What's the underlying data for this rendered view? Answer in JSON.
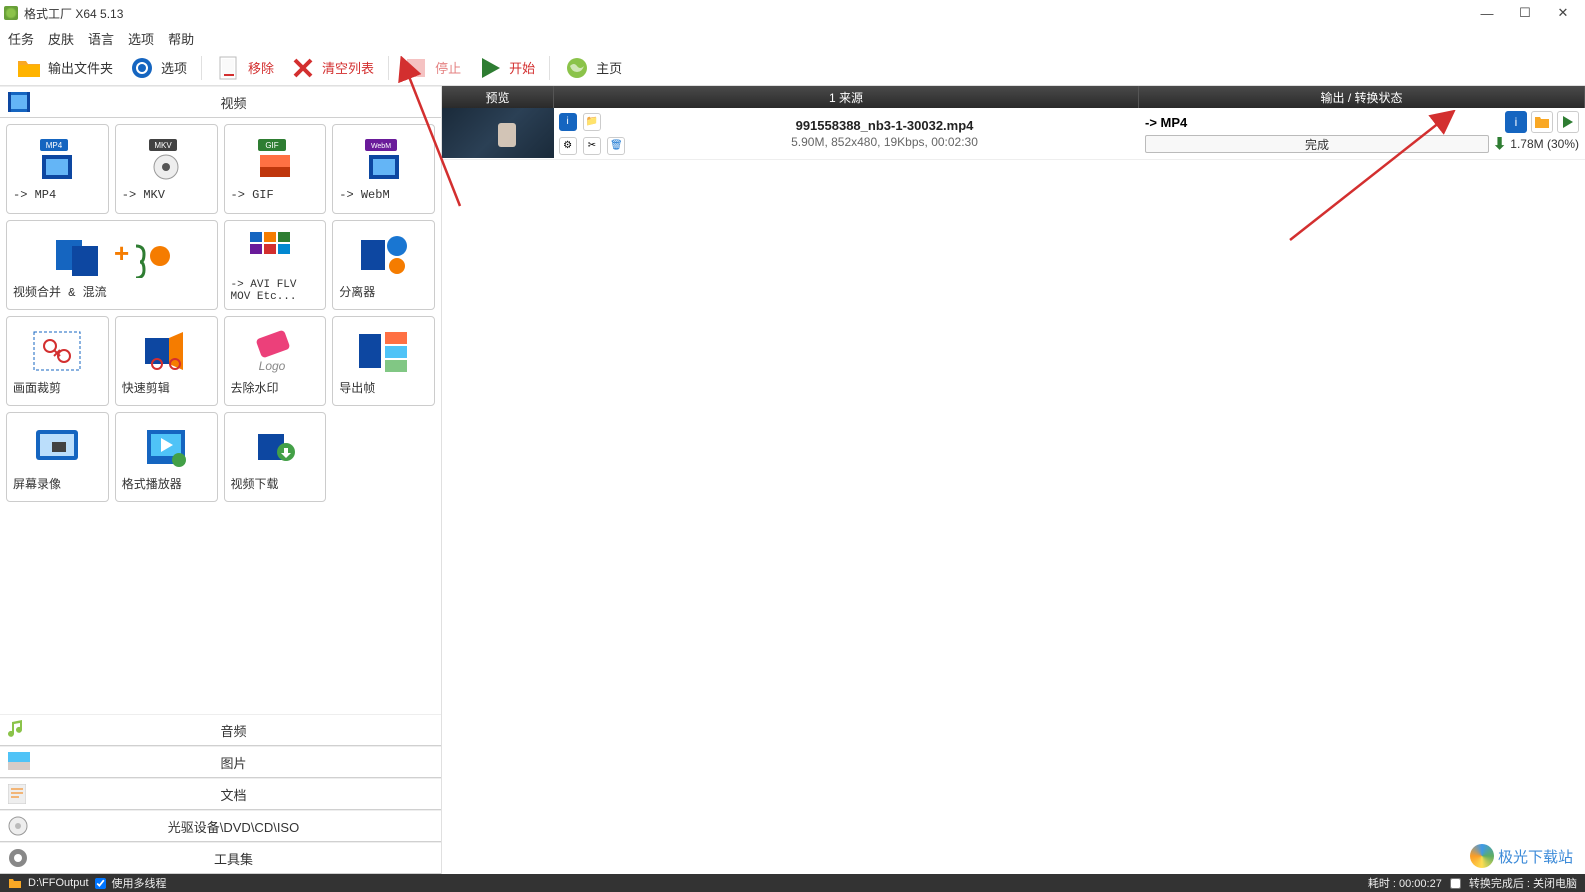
{
  "app": {
    "title": "格式工厂 X64 5.13"
  },
  "menu": {
    "task": "任务",
    "skin": "皮肤",
    "lang": "语言",
    "option": "选项",
    "help": "帮助"
  },
  "toolbar": {
    "output_folder": "输出文件夹",
    "options": "选项",
    "remove": "移除",
    "clear": "清空列表",
    "stop": "停止",
    "start": "开始",
    "home": "主页"
  },
  "categories": {
    "video": "视频",
    "audio": "音频",
    "image": "图片",
    "document": "文档",
    "disc": "光驱设备\\DVD\\CD\\ISO",
    "tools": "工具集"
  },
  "video_tools": {
    "mp4": "-> MP4",
    "mkv": "-> MKV",
    "gif": "-> GIF",
    "webm": "-> WebM",
    "merge": "视频合并 & 混流",
    "avi_etc": "-> AVI FLV MOV Etc...",
    "splitter": "分离器",
    "crop": "画面裁剪",
    "quick_cut": "快速剪辑",
    "remove_wm": "去除水印",
    "export_frame": "导出帧",
    "screen_rec": "屏幕录像",
    "player": "格式播放器",
    "video_dl": "视频下载"
  },
  "task_header": {
    "preview": "预览",
    "source": "1 来源",
    "output": "输出 / 转换状态"
  },
  "task": {
    "filename": "991558388_nb3-1-30032.mp4",
    "meta": "5.90M, 852x480, 19Kbps, 00:02:30",
    "output_format": "->  MP4",
    "progress_label": "完成",
    "output_size": "1.78M  (30%)"
  },
  "status": {
    "output_path": "D:\\FFOutput",
    "multithread": "使用多线程",
    "elapsed": "耗时 : 00:00:27",
    "shutdown": "转换完成后 : 关闭电脑"
  },
  "watermark": "极光下载站"
}
